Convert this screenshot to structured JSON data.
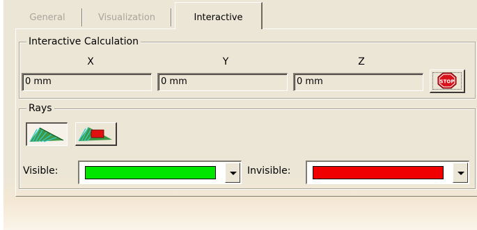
{
  "tabs": [
    {
      "label": "General",
      "active": false
    },
    {
      "label": "Visualization",
      "active": false
    },
    {
      "label": "Interactive",
      "active": true
    }
  ],
  "interactive_calculation": {
    "title": "Interactive Calculation",
    "axes": [
      {
        "label": "X",
        "value": "0 mm"
      },
      {
        "label": "Y",
        "value": "0 mm"
      },
      {
        "label": "Z",
        "value": "0 mm"
      }
    ],
    "stop_icon": "stop-sign-icon",
    "stop_text": "STOP"
  },
  "rays": {
    "title": "Rays",
    "buttons": [
      {
        "icon": "rays-visible-icon",
        "pressed": true
      },
      {
        "icon": "rays-invisible-icon",
        "pressed": false
      }
    ],
    "visible_label": "Visible:",
    "visible_color": "#00e600",
    "invisible_label": "Invisible:",
    "invisible_color": "#f00000"
  }
}
